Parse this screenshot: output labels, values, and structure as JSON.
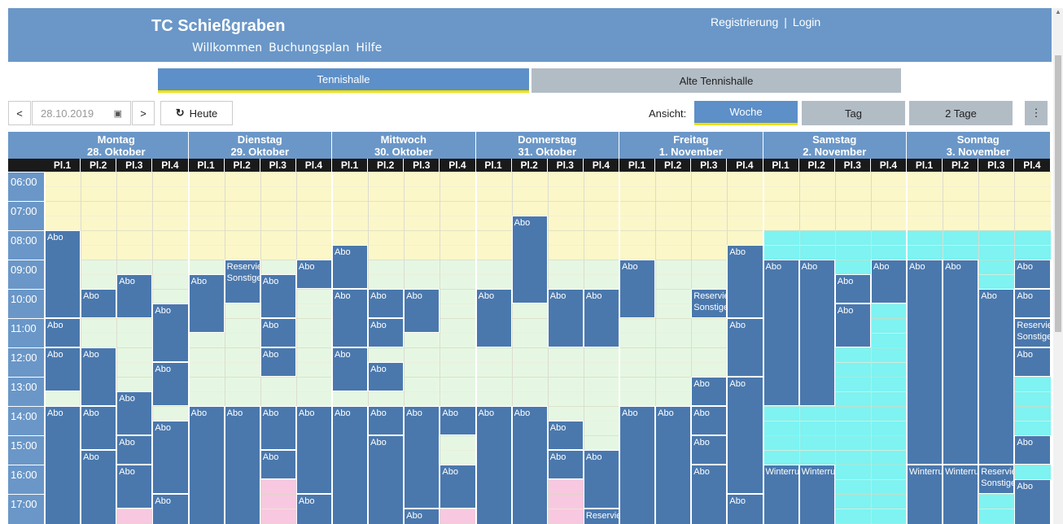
{
  "header": {
    "title": "TC Schießgraben",
    "nav": [
      "Willkommen",
      "Buchungsplan",
      "Hilfe"
    ],
    "register": "Registrierung",
    "separator": "|",
    "login": "Login"
  },
  "halls": {
    "active": "Tennishalle",
    "other": "Alte Tennishalle"
  },
  "toolbar": {
    "prev": "<",
    "date": "28.10.2019",
    "next": ">",
    "today": "Heute",
    "view_label": "Ansicht:",
    "views": [
      "Woche",
      "Tag",
      "2 Tage"
    ],
    "more": "⋮"
  },
  "colors": {
    "header": "#6a97c8",
    "booking": "#4a78ad",
    "morning": "#fbf7c8",
    "day": "#e5f7e2",
    "evening": "#f8c8e0",
    "weekend": "#7ef3f1"
  },
  "days": [
    {
      "name": "Montag",
      "date": "28. Oktober"
    },
    {
      "name": "Dienstag",
      "date": "29. Oktober"
    },
    {
      "name": "Mittwoch",
      "date": "30. Oktober"
    },
    {
      "name": "Donnerstag",
      "date": "31. Oktober"
    },
    {
      "name": "Freitag",
      "date": "1. November"
    },
    {
      "name": "Samstag",
      "date": "2. November"
    },
    {
      "name": "Sonntag",
      "date": "3. November"
    }
  ],
  "courts": [
    "Pl.1",
    "Pl.2",
    "Pl.3",
    "Pl.4"
  ],
  "times": [
    "06:00",
    "07:00",
    "08:00",
    "09:00",
    "10:00",
    "11:00",
    "12:00",
    "13:00",
    "14:00",
    "15:00",
    "16:00",
    "17:00"
  ],
  "bookings": [
    {
      "d": 0,
      "c": 0,
      "s": 8.0,
      "e": 11.0,
      "t": "Abo"
    },
    {
      "d": 0,
      "c": 0,
      "s": 11.0,
      "e": 12.0,
      "t": "Abo"
    },
    {
      "d": 0,
      "c": 0,
      "s": 12.0,
      "e": 13.5,
      "t": "Abo"
    },
    {
      "d": 0,
      "c": 0,
      "s": 14.0,
      "e": 18.5,
      "t": "Abo"
    },
    {
      "d": 0,
      "c": 1,
      "s": 10.0,
      "e": 11.0,
      "t": "Abo"
    },
    {
      "d": 0,
      "c": 1,
      "s": 12.0,
      "e": 14.0,
      "t": "Abo"
    },
    {
      "d": 0,
      "c": 1,
      "s": 14.0,
      "e": 15.5,
      "t": "Abo"
    },
    {
      "d": 0,
      "c": 1,
      "s": 15.5,
      "e": 18.5,
      "t": "Abo"
    },
    {
      "d": 0,
      "c": 2,
      "s": 9.5,
      "e": 11.0,
      "t": "Abo"
    },
    {
      "d": 0,
      "c": 2,
      "s": 13.5,
      "e": 15.0,
      "t": "Abo"
    },
    {
      "d": 0,
      "c": 2,
      "s": 15.0,
      "e": 16.0,
      "t": "Abo"
    },
    {
      "d": 0,
      "c": 2,
      "s": 16.0,
      "e": 17.5,
      "t": "Abo"
    },
    {
      "d": 0,
      "c": 3,
      "s": 10.5,
      "e": 12.5,
      "t": "Abo"
    },
    {
      "d": 0,
      "c": 3,
      "s": 12.5,
      "e": 14.0,
      "t": "Abo"
    },
    {
      "d": 0,
      "c": 3,
      "s": 14.5,
      "e": 17.0,
      "t": "Abo"
    },
    {
      "d": 0,
      "c": 3,
      "s": 17.0,
      "e": 18.5,
      "t": "Abo"
    },
    {
      "d": 1,
      "c": 0,
      "s": 9.5,
      "e": 11.5,
      "t": "Abo"
    },
    {
      "d": 1,
      "c": 0,
      "s": 14.0,
      "e": 18.5,
      "t": "Abo"
    },
    {
      "d": 1,
      "c": 1,
      "s": 9.0,
      "e": 10.5,
      "t": "Reservierung Sonstige"
    },
    {
      "d": 1,
      "c": 1,
      "s": 14.0,
      "e": 18.5,
      "t": "Abo"
    },
    {
      "d": 1,
      "c": 2,
      "s": 9.5,
      "e": 11.0,
      "t": "Abo"
    },
    {
      "d": 1,
      "c": 2,
      "s": 11.0,
      "e": 12.0,
      "t": "Abo"
    },
    {
      "d": 1,
      "c": 2,
      "s": 12.0,
      "e": 13.0,
      "t": "Abo"
    },
    {
      "d": 1,
      "c": 2,
      "s": 14.0,
      "e": 15.5,
      "t": "Abo"
    },
    {
      "d": 1,
      "c": 2,
      "s": 15.5,
      "e": 16.5,
      "t": "Abo"
    },
    {
      "d": 1,
      "c": 3,
      "s": 9.0,
      "e": 10.0,
      "t": "Abo"
    },
    {
      "d": 1,
      "c": 3,
      "s": 14.0,
      "e": 17.0,
      "t": "Abo"
    },
    {
      "d": 1,
      "c": 3,
      "s": 17.0,
      "e": 18.5,
      "t": "Abo"
    },
    {
      "d": 2,
      "c": 0,
      "s": 8.5,
      "e": 10.0,
      "t": "Abo"
    },
    {
      "d": 2,
      "c": 0,
      "s": 10.0,
      "e": 12.0,
      "t": "Abo"
    },
    {
      "d": 2,
      "c": 0,
      "s": 12.0,
      "e": 13.5,
      "t": "Abo"
    },
    {
      "d": 2,
      "c": 0,
      "s": 14.0,
      "e": 18.5,
      "t": "Abo"
    },
    {
      "d": 2,
      "c": 1,
      "s": 10.0,
      "e": 11.0,
      "t": "Abo"
    },
    {
      "d": 2,
      "c": 1,
      "s": 11.0,
      "e": 12.0,
      "t": "Abo"
    },
    {
      "d": 2,
      "c": 1,
      "s": 12.5,
      "e": 13.5,
      "t": "Abo"
    },
    {
      "d": 2,
      "c": 1,
      "s": 14.0,
      "e": 15.0,
      "t": "Abo"
    },
    {
      "d": 2,
      "c": 1,
      "s": 15.0,
      "e": 18.5,
      "t": "Abo"
    },
    {
      "d": 2,
      "c": 2,
      "s": 10.0,
      "e": 11.5,
      "t": "Abo"
    },
    {
      "d": 2,
      "c": 2,
      "s": 14.0,
      "e": 17.5,
      "t": "Abo"
    },
    {
      "d": 2,
      "c": 2,
      "s": 17.5,
      "e": 18.5,
      "t": "Abo"
    },
    {
      "d": 2,
      "c": 3,
      "s": 14.0,
      "e": 15.0,
      "t": "Abo"
    },
    {
      "d": 2,
      "c": 3,
      "s": 16.0,
      "e": 17.5,
      "t": "Abo"
    },
    {
      "d": 3,
      "c": 0,
      "s": 10.0,
      "e": 12.0,
      "t": "Abo"
    },
    {
      "d": 3,
      "c": 0,
      "s": 14.0,
      "e": 18.5,
      "t": "Abo"
    },
    {
      "d": 3,
      "c": 1,
      "s": 7.5,
      "e": 10.5,
      "t": "Abo"
    },
    {
      "d": 3,
      "c": 1,
      "s": 14.0,
      "e": 18.5,
      "t": "Abo"
    },
    {
      "d": 3,
      "c": 2,
      "s": 10.0,
      "e": 12.0,
      "t": "Abo"
    },
    {
      "d": 3,
      "c": 2,
      "s": 14.5,
      "e": 15.5,
      "t": "Abo"
    },
    {
      "d": 3,
      "c": 2,
      "s": 15.5,
      "e": 16.5,
      "t": "Abo"
    },
    {
      "d": 3,
      "c": 3,
      "s": 10.0,
      "e": 12.0,
      "t": "Abo"
    },
    {
      "d": 3,
      "c": 3,
      "s": 15.5,
      "e": 17.5,
      "t": "Abo"
    },
    {
      "d": 3,
      "c": 3,
      "s": 17.5,
      "e": 18.5,
      "t": "Reservierung"
    },
    {
      "d": 4,
      "c": 0,
      "s": 9.0,
      "e": 11.0,
      "t": "Abo"
    },
    {
      "d": 4,
      "c": 0,
      "s": 14.0,
      "e": 18.5,
      "t": "Abo"
    },
    {
      "d": 4,
      "c": 1,
      "s": 14.0,
      "e": 18.5,
      "t": "Abo"
    },
    {
      "d": 4,
      "c": 2,
      "s": 10.0,
      "e": 11.0,
      "t": "Reservierung Sonstige"
    },
    {
      "d": 4,
      "c": 2,
      "s": 13.0,
      "e": 14.0,
      "t": "Abo"
    },
    {
      "d": 4,
      "c": 2,
      "s": 14.0,
      "e": 15.0,
      "t": "Abo"
    },
    {
      "d": 4,
      "c": 2,
      "s": 15.0,
      "e": 16.0,
      "t": "Abo"
    },
    {
      "d": 4,
      "c": 2,
      "s": 16.0,
      "e": 18.5,
      "t": "Abo"
    },
    {
      "d": 4,
      "c": 3,
      "s": 8.5,
      "e": 11.0,
      "t": "Abo"
    },
    {
      "d": 4,
      "c": 3,
      "s": 11.0,
      "e": 13.0,
      "t": "Abo"
    },
    {
      "d": 4,
      "c": 3,
      "s": 13.0,
      "e": 17.0,
      "t": "Abo"
    },
    {
      "d": 4,
      "c": 3,
      "s": 17.0,
      "e": 18.5,
      "t": "Abo"
    },
    {
      "d": 5,
      "c": 0,
      "s": 9.0,
      "e": 14.0,
      "t": "Abo"
    },
    {
      "d": 5,
      "c": 0,
      "s": 16.0,
      "e": 18.5,
      "t": "Winterrunde"
    },
    {
      "d": 5,
      "c": 1,
      "s": 9.0,
      "e": 14.0,
      "t": "Abo"
    },
    {
      "d": 5,
      "c": 1,
      "s": 16.0,
      "e": 18.5,
      "t": "Winterrunde"
    },
    {
      "d": 5,
      "c": 2,
      "s": 9.5,
      "e": 10.5,
      "t": "Abo"
    },
    {
      "d": 5,
      "c": 2,
      "s": 10.5,
      "e": 12.0,
      "t": "Abo"
    },
    {
      "d": 5,
      "c": 3,
      "s": 9.0,
      "e": 10.5,
      "t": "Abo"
    },
    {
      "d": 6,
      "c": 0,
      "s": 9.0,
      "e": 16.0,
      "t": "Abo"
    },
    {
      "d": 6,
      "c": 0,
      "s": 16.0,
      "e": 18.5,
      "t": "Winterrunde"
    },
    {
      "d": 6,
      "c": 1,
      "s": 9.0,
      "e": 16.0,
      "t": "Abo"
    },
    {
      "d": 6,
      "c": 1,
      "s": 16.0,
      "e": 18.5,
      "t": "Winterrunde"
    },
    {
      "d": 6,
      "c": 2,
      "s": 10.0,
      "e": 16.0,
      "t": "Abo"
    },
    {
      "d": 6,
      "c": 2,
      "s": 16.0,
      "e": 17.0,
      "t": "Reservierung Sonstige"
    },
    {
      "d": 6,
      "c": 3,
      "s": 9.0,
      "e": 10.0,
      "t": "Abo"
    },
    {
      "d": 6,
      "c": 3,
      "s": 10.0,
      "e": 11.0,
      "t": "Abo"
    },
    {
      "d": 6,
      "c": 3,
      "s": 11.0,
      "e": 12.0,
      "t": "Reservierung Sonstige"
    },
    {
      "d": 6,
      "c": 3,
      "s": 12.0,
      "e": 13.0,
      "t": "Abo"
    },
    {
      "d": 6,
      "c": 3,
      "s": 15.0,
      "e": 16.0,
      "t": "Abo"
    },
    {
      "d": 6,
      "c": 3,
      "s": 16.5,
      "e": 18.5,
      "t": "Abo"
    }
  ]
}
